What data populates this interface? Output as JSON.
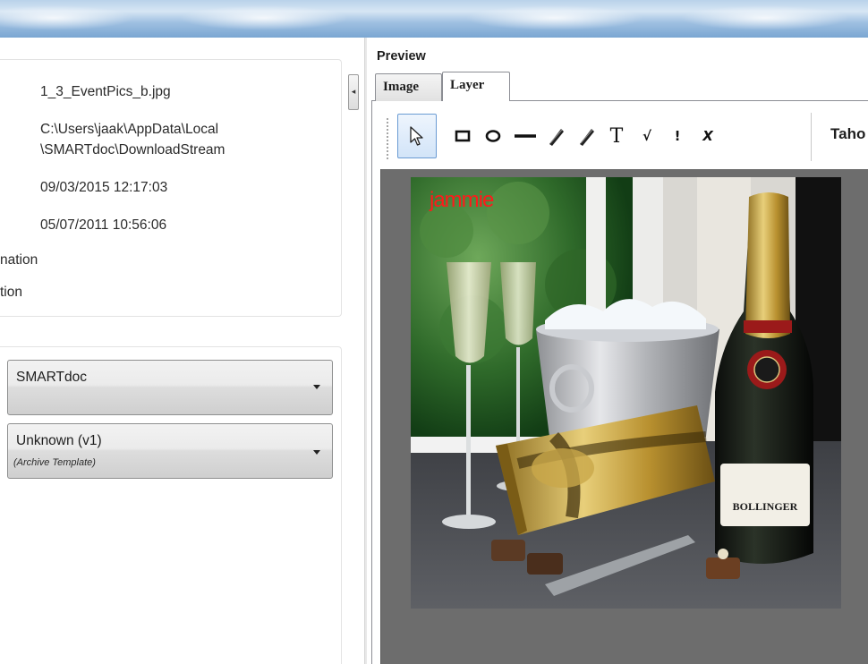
{
  "left_panel": {
    "details": {
      "file_name": "1_3_EventPics_b.jpg",
      "path_line1": "C:\\Users\\jaak\\AppData\\Local",
      "path_line2": "\\SMARTdoc\\DownloadStream",
      "date_1": "09/03/2015 12:17:03",
      "date_2": "05/07/2011 10:56:06",
      "label_truncated_1": "nation",
      "label_truncated_2": "tion"
    },
    "archive": {
      "combo_1_value": "SMARTdoc",
      "combo_2_value": "Unknown (v1)",
      "combo_2_sub": "(Archive Template)"
    },
    "collapse_glyph": "◂"
  },
  "preview": {
    "label": "Preview",
    "tabs": [
      {
        "label": "Image",
        "selected": false
      },
      {
        "label": "Layer",
        "selected": true
      }
    ],
    "toolbar": {
      "tools": [
        "select-arrow",
        "rectangle",
        "ellipse",
        "line",
        "pen",
        "highlighter",
        "text",
        "check",
        "exclamation",
        "cross"
      ],
      "text_tool_glyph": "T",
      "check_glyph": "√",
      "exclamation_glyph": "!",
      "cross_glyph": "X",
      "font_name": "Taho"
    },
    "annotation_text": "jammie",
    "bottle_label": "BOLLINGER"
  },
  "colors": {
    "annotation": "#ff1a1a",
    "selected_tool_border": "#6a9bd3",
    "canvas_background": "#6d6d6d"
  }
}
